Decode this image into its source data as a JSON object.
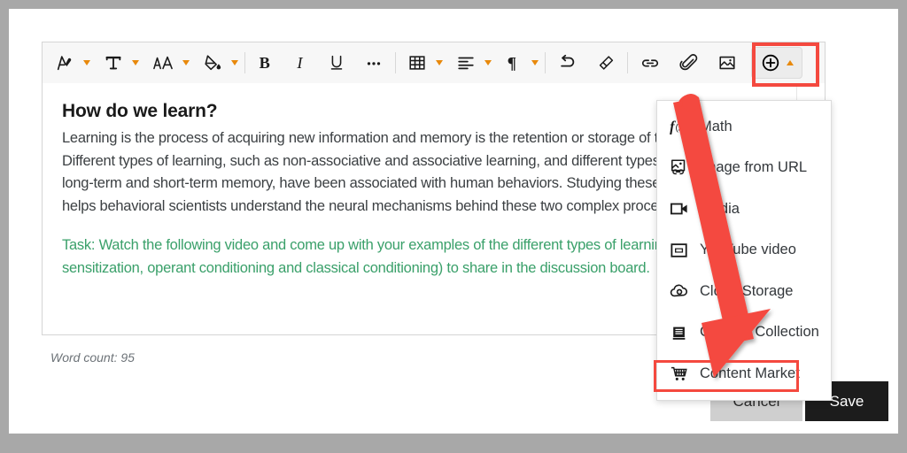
{
  "toolbar": {
    "items": [
      {
        "name": "highlight-pen-icon",
        "label": "Highlight",
        "has_caret": true
      },
      {
        "name": "text-color-icon",
        "label": "Text Color",
        "has_caret": true
      },
      {
        "name": "font-size-icon",
        "label": "Font Size",
        "has_caret": true
      },
      {
        "name": "fill-color-icon",
        "label": "Fill Color",
        "has_caret": true
      },
      {
        "name": "bold-icon",
        "label": "Bold",
        "has_caret": false
      },
      {
        "name": "italic-icon",
        "label": "Italic",
        "has_caret": false
      },
      {
        "name": "underline-icon",
        "label": "Underline",
        "has_caret": false
      },
      {
        "name": "more-options-icon",
        "label": "More",
        "has_caret": false
      },
      {
        "name": "table-icon",
        "label": "Table",
        "has_caret": true
      },
      {
        "name": "align-left-icon",
        "label": "Align",
        "has_caret": true
      },
      {
        "name": "paragraph-icon",
        "label": "Paragraph",
        "has_caret": true
      },
      {
        "name": "undo-icon",
        "label": "Undo",
        "has_caret": false
      },
      {
        "name": "clear-formatting-icon",
        "label": "Clear Formatting",
        "has_caret": false
      },
      {
        "name": "link-icon",
        "label": "Link",
        "has_caret": false
      },
      {
        "name": "attachment-icon",
        "label": "Attach File",
        "has_caret": false
      },
      {
        "name": "insert-image-icon",
        "label": "Insert Image",
        "has_caret": false
      },
      {
        "name": "add-content-icon",
        "label": "Add Content",
        "has_caret": true
      }
    ]
  },
  "document": {
    "title": "How do we learn?",
    "paragraphs": [
      "Learning is the process of acquiring new information and memory is the retention or storage of that information.",
      "Different types of learning, such as non-associative and associative learning, and different types of memory, such as",
      "long-term and short-term memory, have been associated with human behaviors. Studying these concepts in detail",
      "helps behavioral scientists understand the neural mechanisms behind these two complex processes."
    ],
    "task_paragraphs": [
      "Task: Watch the following video and come up with your examples of the different types of learning (habituation,",
      "sensitization, operant conditioning and classical conditioning) to share in the discussion board."
    ]
  },
  "status": {
    "word_count_label": "Word count: 95"
  },
  "actions": {
    "cancel_label": "Cancel",
    "save_label": "Save"
  },
  "dropdown": {
    "items": [
      {
        "icon": "math-function-icon",
        "label": "Math"
      },
      {
        "icon": "image-from-url-icon",
        "label": "Image from URL"
      },
      {
        "icon": "media-camera-icon",
        "label": "Media"
      },
      {
        "icon": "youtube-video-icon",
        "label": "YouTube video"
      },
      {
        "icon": "cloud-storage-icon",
        "label": "Cloud Storage"
      },
      {
        "icon": "content-collection-icon",
        "label": "Content Collection"
      },
      {
        "icon": "content-market-cart-icon",
        "label": "Content Market"
      }
    ]
  },
  "annotations": {
    "highlight_color": "#f4493f",
    "arrow_color": "#f4493f",
    "target_item": "Content Market"
  },
  "colors": {
    "accent_caret": "#e8890c",
    "task_text": "#3aa06a",
    "body_text": "#3c4043",
    "save_bg": "#1c1c1c",
    "cancel_bg": "#cfcfcf"
  }
}
